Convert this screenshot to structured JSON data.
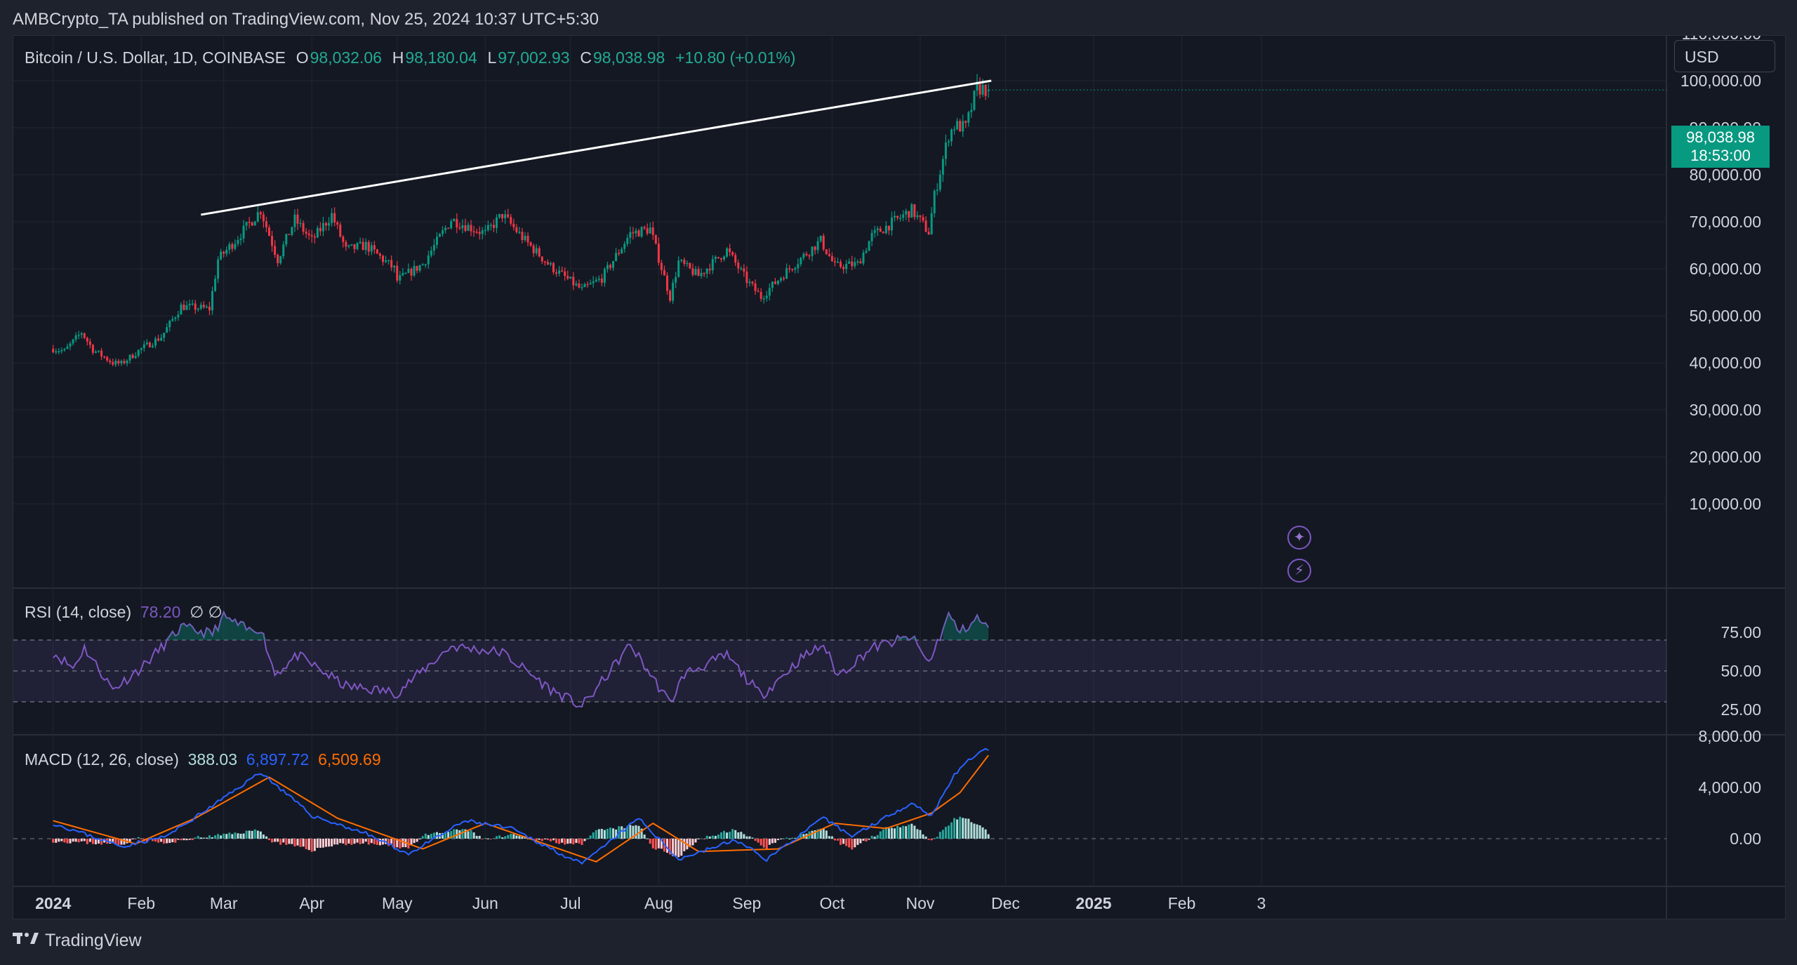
{
  "publisher": "AMBCrypto_TA published on TradingView.com, Nov 25, 2024 10:37 UTC+5:30",
  "brand": "TradingView",
  "currency": "USD",
  "legend": {
    "symbol": "Bitcoin / U.S. Dollar, 1D, COINBASE",
    "o_label": "O",
    "o_value": "98,032.06",
    "h_label": "H",
    "h_value": "98,180.04",
    "l_label": "L",
    "l_value": "97,002.93",
    "c_label": "C",
    "c_value": "98,038.98",
    "change": "+10.80 (+0.01%)"
  },
  "price_tag": {
    "price": "98,038.98",
    "countdown": "18:53:00"
  },
  "rsi_legend": {
    "label": "RSI (14, close)",
    "value": "78.20",
    "extra": "∅ ∅"
  },
  "macd_legend": {
    "label": "MACD (12, 26, close)",
    "hist": "388.03",
    "macd": "6,897.72",
    "signal": "6,509.69"
  },
  "colors": {
    "up": "#089981",
    "down": "#f23645",
    "rsi": "#7e57c2",
    "macd": "#2962ff",
    "signal": "#ff6d00",
    "trendline": "#ffffff"
  },
  "icons": [
    "sparkle-icon",
    "lightning-icon",
    "tradingview-logo-icon"
  ],
  "chart_data": [
    {
      "type": "candlestick",
      "title": "Bitcoin / U.S. Dollar, 1D, COINBASE",
      "x_ticks": [
        "2024",
        "Feb",
        "Mar",
        "Apr",
        "May",
        "Jun",
        "Jul",
        "Aug",
        "Sep",
        "Oct",
        "Nov",
        "Dec",
        "2025",
        "Feb",
        "3"
      ],
      "y_ticks": [
        "10,000.00",
        "20,000.00",
        "30,000.00",
        "40,000.00",
        "50,000.00",
        "60,000.00",
        "70,000.00",
        "80,000.00",
        "90,000.00",
        "100,000.00",
        "110,000.00"
      ],
      "ylim": [
        0,
        112000
      ],
      "close_anchors": [
        {
          "x": "2024-01-01",
          "y": 43000
        },
        {
          "x": "2024-01-05",
          "y": 42500
        },
        {
          "x": "2024-01-11",
          "y": 46500
        },
        {
          "x": "2024-01-15",
          "y": 42800
        },
        {
          "x": "2024-01-22",
          "y": 40000
        },
        {
          "x": "2024-01-25",
          "y": 39800
        },
        {
          "x": "2024-02-01",
          "y": 43000
        },
        {
          "x": "2024-02-08",
          "y": 45500
        },
        {
          "x": "2024-02-15",
          "y": 52000
        },
        {
          "x": "2024-02-25",
          "y": 51500
        },
        {
          "x": "2024-02-28",
          "y": 62000
        },
        {
          "x": "2024-03-05",
          "y": 66000
        },
        {
          "x": "2024-03-14",
          "y": 72500
        },
        {
          "x": "2024-03-20",
          "y": 62000
        },
        {
          "x": "2024-03-26",
          "y": 70500
        },
        {
          "x": "2024-04-01",
          "y": 66000
        },
        {
          "x": "2024-04-08",
          "y": 71500
        },
        {
          "x": "2024-04-13",
          "y": 64000
        },
        {
          "x": "2024-04-20",
          "y": 65000
        },
        {
          "x": "2024-04-30",
          "y": 60000
        },
        {
          "x": "2024-05-01",
          "y": 57500
        },
        {
          "x": "2024-05-10",
          "y": 61000
        },
        {
          "x": "2024-05-20",
          "y": 70500
        },
        {
          "x": "2024-06-01",
          "y": 67500
        },
        {
          "x": "2024-06-07",
          "y": 71500
        },
        {
          "x": "2024-06-15",
          "y": 66000
        },
        {
          "x": "2024-06-24",
          "y": 60500
        },
        {
          "x": "2024-07-05",
          "y": 55500
        },
        {
          "x": "2024-07-12",
          "y": 58000
        },
        {
          "x": "2024-07-22",
          "y": 67500
        },
        {
          "x": "2024-07-29",
          "y": 68500
        },
        {
          "x": "2024-08-05",
          "y": 54000
        },
        {
          "x": "2024-08-08",
          "y": 61500
        },
        {
          "x": "2024-08-15",
          "y": 58500
        },
        {
          "x": "2024-08-25",
          "y": 64000
        },
        {
          "x": "2024-09-01",
          "y": 57500
        },
        {
          "x": "2024-09-06",
          "y": 54000
        },
        {
          "x": "2024-09-15",
          "y": 59500
        },
        {
          "x": "2024-09-27",
          "y": 66000
        },
        {
          "x": "2024-10-02",
          "y": 60500
        },
        {
          "x": "2024-10-10",
          "y": 61000
        },
        {
          "x": "2024-10-15",
          "y": 67000
        },
        {
          "x": "2024-10-29",
          "y": 72500
        },
        {
          "x": "2024-11-04",
          "y": 67800
        },
        {
          "x": "2024-11-06",
          "y": 75500
        },
        {
          "x": "2024-11-11",
          "y": 88500
        },
        {
          "x": "2024-11-13",
          "y": 90500
        },
        {
          "x": "2024-11-17",
          "y": 90000
        },
        {
          "x": "2024-11-21",
          "y": 98500
        },
        {
          "x": "2024-11-25",
          "y": 98039
        }
      ],
      "current": {
        "open": 98032.06,
        "high": 98180.04,
        "low": 97002.93,
        "close": 98038.98
      },
      "trendline": [
        {
          "x": "2024-02-22",
          "y": 71500
        },
        {
          "x": "2024-11-26",
          "y": 100000
        }
      ]
    },
    {
      "type": "line",
      "title": "RSI (14, close)",
      "y_ticks": [
        "25.00",
        "50.00",
        "75.00"
      ],
      "band": [
        30,
        70
      ],
      "ylim": [
        20,
        90
      ],
      "anchors": [
        {
          "x": "2024-01-01",
          "y": 62
        },
        {
          "x": "2024-01-08",
          "y": 52
        },
        {
          "x": "2024-01-12",
          "y": 65
        },
        {
          "x": "2024-01-22",
          "y": 38
        },
        {
          "x": "2024-02-01",
          "y": 52
        },
        {
          "x": "2024-02-15",
          "y": 78
        },
        {
          "x": "2024-02-26",
          "y": 74
        },
        {
          "x": "2024-03-01",
          "y": 85
        },
        {
          "x": "2024-03-10",
          "y": 76
        },
        {
          "x": "2024-03-14",
          "y": 78
        },
        {
          "x": "2024-03-19",
          "y": 48
        },
        {
          "x": "2024-03-27",
          "y": 60
        },
        {
          "x": "2024-04-13",
          "y": 40
        },
        {
          "x": "2024-05-01",
          "y": 36
        },
        {
          "x": "2024-05-20",
          "y": 66
        },
        {
          "x": "2024-06-07",
          "y": 62
        },
        {
          "x": "2024-06-24",
          "y": 38
        },
        {
          "x": "2024-07-05",
          "y": 27
        },
        {
          "x": "2024-07-10",
          "y": 38
        },
        {
          "x": "2024-07-22",
          "y": 67
        },
        {
          "x": "2024-08-05",
          "y": 29
        },
        {
          "x": "2024-08-10",
          "y": 48
        },
        {
          "x": "2024-08-25",
          "y": 60
        },
        {
          "x": "2024-09-06",
          "y": 34
        },
        {
          "x": "2024-09-20",
          "y": 58
        },
        {
          "x": "2024-09-28",
          "y": 67
        },
        {
          "x": "2024-10-03",
          "y": 47
        },
        {
          "x": "2024-10-15",
          "y": 65
        },
        {
          "x": "2024-10-29",
          "y": 72
        },
        {
          "x": "2024-11-04",
          "y": 55
        },
        {
          "x": "2024-11-11",
          "y": 86
        },
        {
          "x": "2024-11-15",
          "y": 75
        },
        {
          "x": "2024-11-21",
          "y": 84
        },
        {
          "x": "2024-11-25",
          "y": 78.2
        }
      ]
    },
    {
      "type": "macd",
      "title": "MACD (12, 26, close)",
      "y_ticks": [
        "0.00",
        "4,000.00",
        "8,000.00"
      ],
      "ylim": [
        -2500,
        8000
      ],
      "macd_anchors": [
        {
          "x": "2024-01-01",
          "y": 1200
        },
        {
          "x": "2024-01-25",
          "y": -600
        },
        {
          "x": "2024-02-10",
          "y": 200
        },
        {
          "x": "2024-02-25",
          "y": 2400
        },
        {
          "x": "2024-03-14",
          "y": 5200
        },
        {
          "x": "2024-04-01",
          "y": 1800
        },
        {
          "x": "2024-04-20",
          "y": 400
        },
        {
          "x": "2024-05-05",
          "y": -1200
        },
        {
          "x": "2024-05-25",
          "y": 1400
        },
        {
          "x": "2024-06-10",
          "y": 800
        },
        {
          "x": "2024-07-05",
          "y": -2000
        },
        {
          "x": "2024-07-25",
          "y": 1600
        },
        {
          "x": "2024-08-08",
          "y": -1600
        },
        {
          "x": "2024-08-28",
          "y": -100
        },
        {
          "x": "2024-09-08",
          "y": -1600
        },
        {
          "x": "2024-09-28",
          "y": 1600
        },
        {
          "x": "2024-10-08",
          "y": 200
        },
        {
          "x": "2024-10-29",
          "y": 2800
        },
        {
          "x": "2024-11-05",
          "y": 1800
        },
        {
          "x": "2024-11-13",
          "y": 5000
        },
        {
          "x": "2024-11-22",
          "y": 6900
        },
        {
          "x": "2024-11-25",
          "y": 6897.72
        }
      ],
      "signal_anchors": [
        {
          "x": "2024-01-01",
          "y": 1400
        },
        {
          "x": "2024-01-30",
          "y": -400
        },
        {
          "x": "2024-02-20",
          "y": 1600
        },
        {
          "x": "2024-03-17",
          "y": 4800
        },
        {
          "x": "2024-04-10",
          "y": 1600
        },
        {
          "x": "2024-05-10",
          "y": -800
        },
        {
          "x": "2024-06-01",
          "y": 1200
        },
        {
          "x": "2024-07-10",
          "y": -1800
        },
        {
          "x": "2024-07-30",
          "y": 1200
        },
        {
          "x": "2024-08-15",
          "y": -1000
        },
        {
          "x": "2024-09-12",
          "y": -800
        },
        {
          "x": "2024-10-02",
          "y": 1200
        },
        {
          "x": "2024-10-20",
          "y": 800
        },
        {
          "x": "2024-11-05",
          "y": 2000
        },
        {
          "x": "2024-11-15",
          "y": 3600
        },
        {
          "x": "2024-11-25",
          "y": 6509.69
        }
      ],
      "current_histogram": 388.03
    }
  ]
}
